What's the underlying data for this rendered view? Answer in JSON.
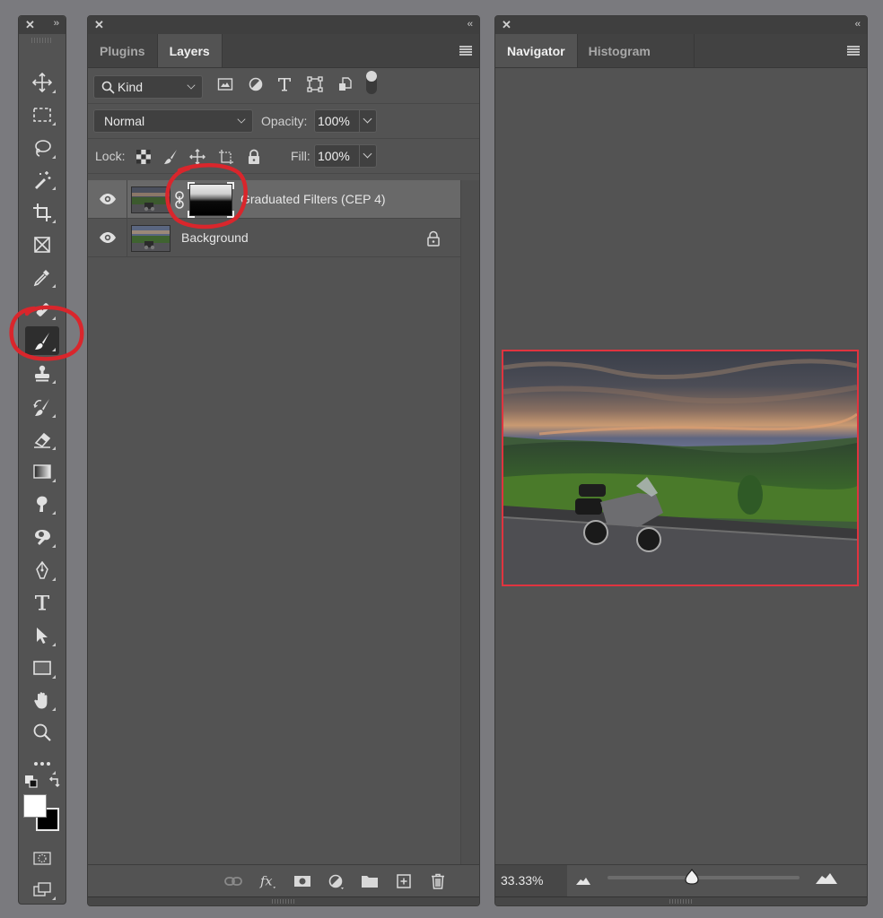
{
  "toolbar": {
    "close_label": "✕",
    "expand_label": "››",
    "tools": [
      {
        "name": "move-tool",
        "icon": "move-icon"
      },
      {
        "name": "marquee-tool",
        "icon": "rectangular-marquee-icon"
      },
      {
        "name": "lasso-tool",
        "icon": "lasso-icon"
      },
      {
        "name": "magic-wand-tool",
        "icon": "magic-wand-icon"
      },
      {
        "name": "crop-tool",
        "icon": "crop-icon"
      },
      {
        "name": "frame-tool",
        "icon": "frame-icon"
      },
      {
        "name": "eyedropper-tool",
        "icon": "eyedropper-icon"
      },
      {
        "name": "healing-brush-tool",
        "icon": "bandage-icon"
      },
      {
        "name": "brush-tool",
        "icon": "brush-icon",
        "active": true
      },
      {
        "name": "clone-stamp-tool",
        "icon": "stamp-icon"
      },
      {
        "name": "history-brush-tool",
        "icon": "history-brush-icon"
      },
      {
        "name": "eraser-tool",
        "icon": "eraser-icon"
      },
      {
        "name": "gradient-tool",
        "icon": "gradient-icon"
      },
      {
        "name": "smudge-tool",
        "icon": "smudge-icon"
      },
      {
        "name": "dodge-tool",
        "icon": "dodge-icon"
      },
      {
        "name": "pen-tool",
        "icon": "pen-icon"
      },
      {
        "name": "type-tool",
        "icon": "type-icon"
      },
      {
        "name": "path-selection-tool",
        "icon": "arrow-icon"
      },
      {
        "name": "rectangle-tool",
        "icon": "rectangle-icon"
      },
      {
        "name": "hand-tool",
        "icon": "hand-icon"
      },
      {
        "name": "zoom-tool",
        "icon": "magnifier-icon"
      },
      {
        "name": "edit-toolbar",
        "icon": "ellipsis-icon"
      }
    ],
    "foreground_color": "#ffffff",
    "background_color": "#000000"
  },
  "layers_panel": {
    "close_label": "✕",
    "collapse_label": "‹‹",
    "tabs": [
      {
        "label": "Plugins",
        "active": false
      },
      {
        "label": "Layers",
        "active": true
      }
    ],
    "filter": {
      "kind_label": "Kind",
      "filter_icons": [
        "pixel-filter-icon",
        "adjustment-filter-icon",
        "type-filter-icon",
        "shape-filter-icon",
        "smart-object-filter-icon"
      ]
    },
    "blend_mode": "Normal",
    "opacity_label": "Opacity:",
    "opacity_value": "100%",
    "lock_label": "Lock:",
    "fill_label": "Fill:",
    "fill_value": "100%",
    "layers": [
      {
        "name": "Graduated Filters (CEP 4)",
        "visible": true,
        "selected": true,
        "has_mask": true,
        "locked": false
      },
      {
        "name": "Background",
        "visible": true,
        "selected": false,
        "has_mask": false,
        "locked": true
      }
    ],
    "footer_icons": [
      "link-layers-icon",
      "fx-icon",
      "add-mask-icon",
      "adjustment-layer-icon",
      "new-group-icon",
      "new-layer-icon",
      "trash-icon"
    ]
  },
  "navigator_panel": {
    "close_label": "✕",
    "collapse_label": "‹‹",
    "tabs": [
      {
        "label": "Navigator",
        "active": true
      },
      {
        "label": "Histogram",
        "active": false
      }
    ],
    "zoom_value": "33.33%",
    "zoom_slider_fraction": 0.44,
    "view_box_color": "#e0343f"
  },
  "annotations": {
    "highlight_color": "#d9262c"
  }
}
